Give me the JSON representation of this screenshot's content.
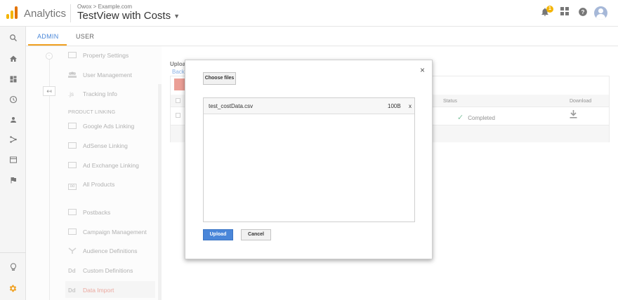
{
  "header": {
    "app_name": "Analytics",
    "breadcrumb": "Owox > Example.com",
    "view_title": "TestView with Costs",
    "notification_count": "1",
    "icons": [
      "bell-icon",
      "apps-grid-icon",
      "help-icon",
      "account-avatar"
    ]
  },
  "rail": {
    "icons": [
      "search-icon",
      "home-icon",
      "customization-icon",
      "realtime-clock-icon",
      "audience-person-icon",
      "acquisition-icon",
      "behavior-icon",
      "conversions-flag-icon",
      "discover-lightbulb-icon",
      "admin-gear-icon"
    ]
  },
  "tabs": [
    {
      "label": "ADMIN",
      "active": true
    },
    {
      "label": "USER",
      "active": false
    }
  ],
  "property_nav": {
    "items": [
      {
        "label": "Property Settings"
      },
      {
        "label": "User Management"
      },
      {
        "label": "Tracking Info",
        "icon_text": ".js"
      }
    ],
    "section_heading": "PRODUCT LINKING",
    "linking_items": [
      {
        "label": "Google Ads Linking"
      },
      {
        "label": "AdSense Linking"
      },
      {
        "label": "Ad Exchange Linking"
      },
      {
        "label": "All Products"
      }
    ],
    "other_items": [
      {
        "label": "Postbacks"
      },
      {
        "label": "Campaign Management"
      },
      {
        "label": "Audience Definitions"
      },
      {
        "label": "Custom Definitions",
        "icon_text": "Dd"
      },
      {
        "label": "Data Import",
        "icon_text": "Dd",
        "active": true
      }
    ]
  },
  "background_page": {
    "title_fragment": "Uploa",
    "back_fragment": "Back",
    "columns": {
      "status": "Status",
      "download": "Download"
    },
    "row": {
      "status": "Completed"
    }
  },
  "modal": {
    "choose_files_label": "Choose files",
    "close_label": "×",
    "files": [
      {
        "name": "test_costData.csv",
        "size": "100B",
        "remove": "x"
      }
    ],
    "upload_label": "Upload",
    "cancel_label": "Cancel"
  },
  "colors": {
    "accent_blue": "#4a86d9",
    "tab_underline": "#f0a020",
    "active_nav": "#e0786a",
    "status_green": "#3fa56f",
    "gear_orange": "#f0a020"
  }
}
